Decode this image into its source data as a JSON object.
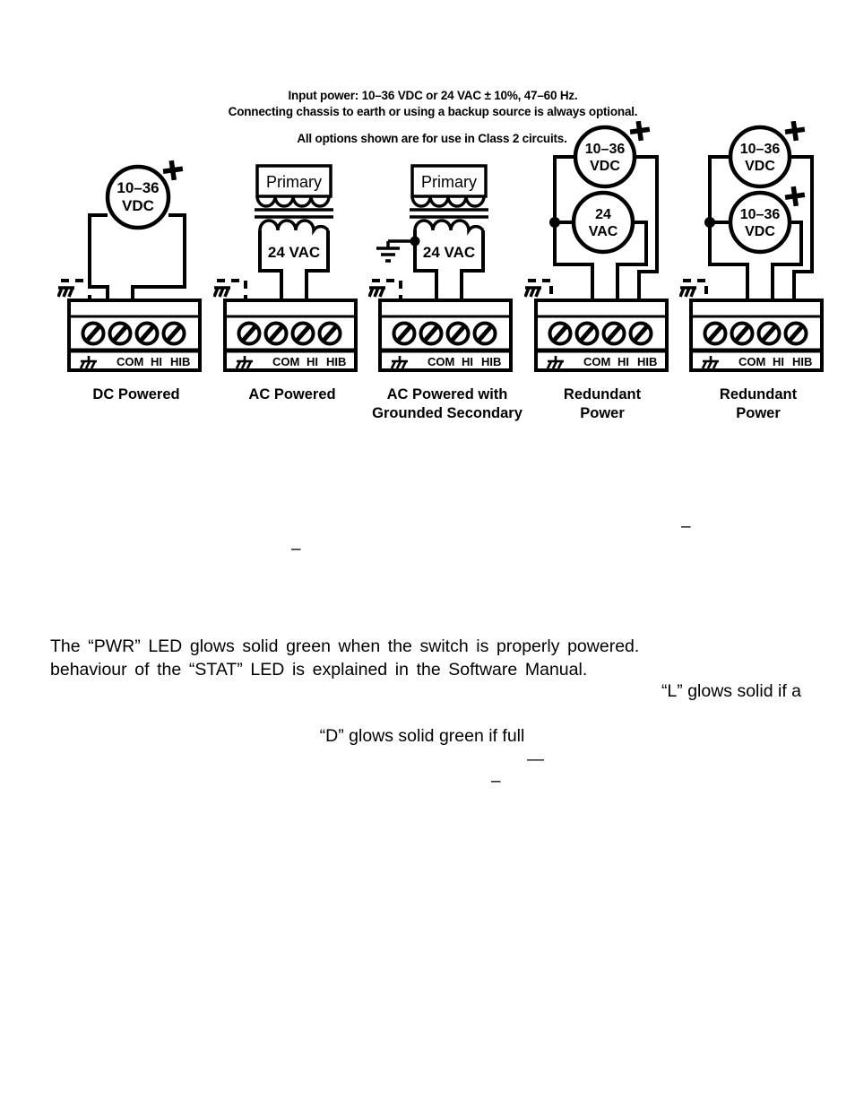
{
  "header": {
    "line1": "Input power:  10–36 VDC   or   24 VAC ± 10%, 47–60 Hz.",
    "line2": "Connecting chassis to earth or using a backup source is always optional.",
    "line3": "All options shown are for use in Class 2 circuits."
  },
  "terminal_labels": {
    "ground": "chassis-ground-symbol",
    "com": "COM",
    "hi": "HI",
    "hib": "HIB"
  },
  "diagrams": [
    {
      "id": "dc-powered",
      "caption": "DC Powered",
      "type": "dc",
      "sources": [
        {
          "label_line1": "10–36",
          "label_line2": "VDC",
          "polarity": "+"
        }
      ]
    },
    {
      "id": "ac-powered",
      "caption": "AC Powered",
      "type": "ac",
      "transformer": {
        "primary_label": "Primary",
        "secondary_label": "24 VAC",
        "secondary_grounded": false
      }
    },
    {
      "id": "ac-powered-grounded-secondary",
      "caption": "AC Powered with Grounded Secondary",
      "caption_line1": "AC Powered with",
      "caption_line2": "Grounded Secondary",
      "type": "ac",
      "transformer": {
        "primary_label": "Primary",
        "secondary_label": "24 VAC",
        "secondary_grounded": true
      }
    },
    {
      "id": "redundant-power-dc-ac",
      "caption": "Redundant Power",
      "caption_line1": "Redundant",
      "caption_line2": "Power",
      "type": "redundant",
      "sources": [
        {
          "label_line1": "10–36",
          "label_line2": "VDC",
          "polarity": "+"
        },
        {
          "label_line1": "24",
          "label_line2": "VAC",
          "polarity": ""
        }
      ]
    },
    {
      "id": "redundant-power-dc-dc",
      "caption": "Redundant Power",
      "caption_line1": "Redundant",
      "caption_line2": "Power",
      "type": "redundant",
      "sources": [
        {
          "label_line1": "10–36",
          "label_line2": "VDC",
          "polarity": "+"
        },
        {
          "label_line1": "10–36",
          "label_line2": "VDC",
          "polarity": "+"
        }
      ]
    }
  ],
  "body": {
    "paragraph_line1": "The “PWR” LED glows solid green when the switch is properly powered.",
    "paragraph_line2": "behaviour of the “STAT” LED is explained in the Software Manual.",
    "fragment_right": "“L” glows solid if a",
    "fragment_center": "“D” glows solid green if full"
  },
  "stray_fragments": {
    "dash_a": "–",
    "dash_b": "–",
    "dash_c": "—",
    "dash_d": "–"
  },
  "colors": {
    "ink": "#000000",
    "paper": "#ffffff"
  }
}
